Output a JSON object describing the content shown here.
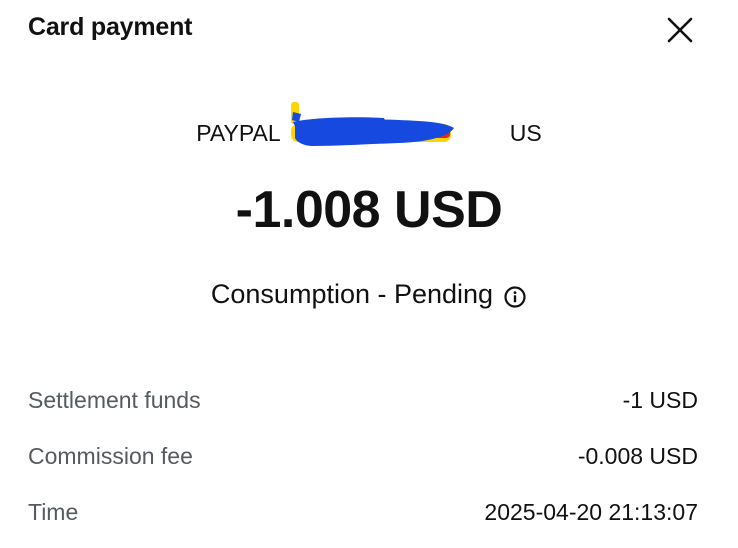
{
  "header": {
    "title": "Card payment",
    "close_icon": "close-icon"
  },
  "transaction": {
    "merchant": "PAYPAL                                    US",
    "merchant_redacted": true,
    "amount": "-1.008 USD",
    "status": "Consumption - Pending",
    "status_icon": "info-icon"
  },
  "details": {
    "rows": [
      {
        "label": "Settlement funds",
        "value": "-1 USD"
      },
      {
        "label": "Commission fee",
        "value": "-0.008 USD"
      },
      {
        "label": "Time",
        "value": "2025-04-20 21:13:07"
      }
    ]
  },
  "colors": {
    "text_primary": "#111111",
    "text_secondary": "#555b61",
    "background": "#ffffff",
    "redaction_blue": "#1649e0",
    "redaction_yellow": "#ffd400",
    "redaction_red": "#e0262b"
  }
}
